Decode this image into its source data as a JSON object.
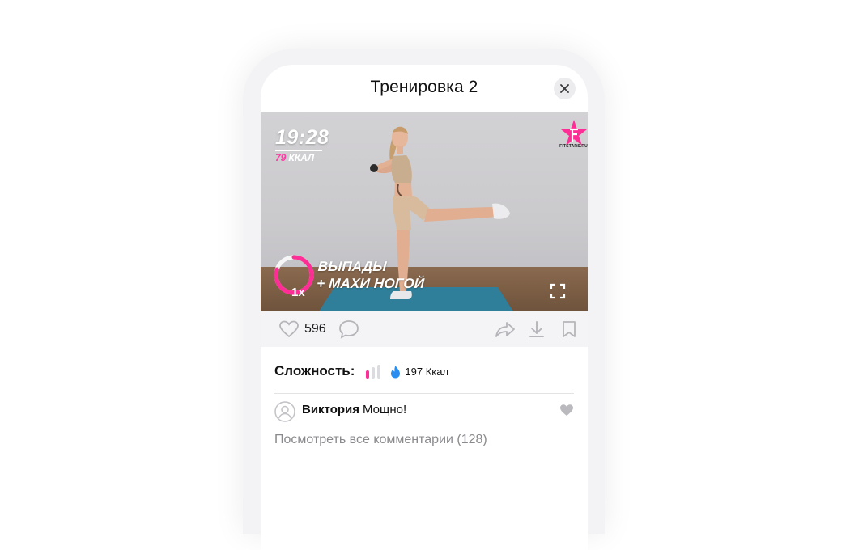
{
  "workout": {
    "title": "Тренировка 2"
  },
  "video": {
    "timer": "19:28",
    "calories_value": "79",
    "calories_unit": "ККАЛ",
    "brand": "FITSTARS.RU",
    "rep_count": "1x",
    "rep_progress_percent": 80,
    "exercise_line1": "ВЫПАДЫ",
    "exercise_line2": "+ МАХИ НОГОЙ",
    "accent_color": "#ff2d95"
  },
  "actions": {
    "likes": "596",
    "icons": [
      "heart-icon",
      "comment-icon",
      "share-icon",
      "download-icon",
      "bookmark-icon"
    ]
  },
  "meta": {
    "difficulty_label": "Сложность:",
    "difficulty_level": 1,
    "difficulty_max": 3,
    "calories": "197 Ккал"
  },
  "comments": {
    "latest": {
      "author": "Виктория",
      "text": "Мощно!"
    },
    "view_all": "Посмотреть все комментарии (128)"
  }
}
